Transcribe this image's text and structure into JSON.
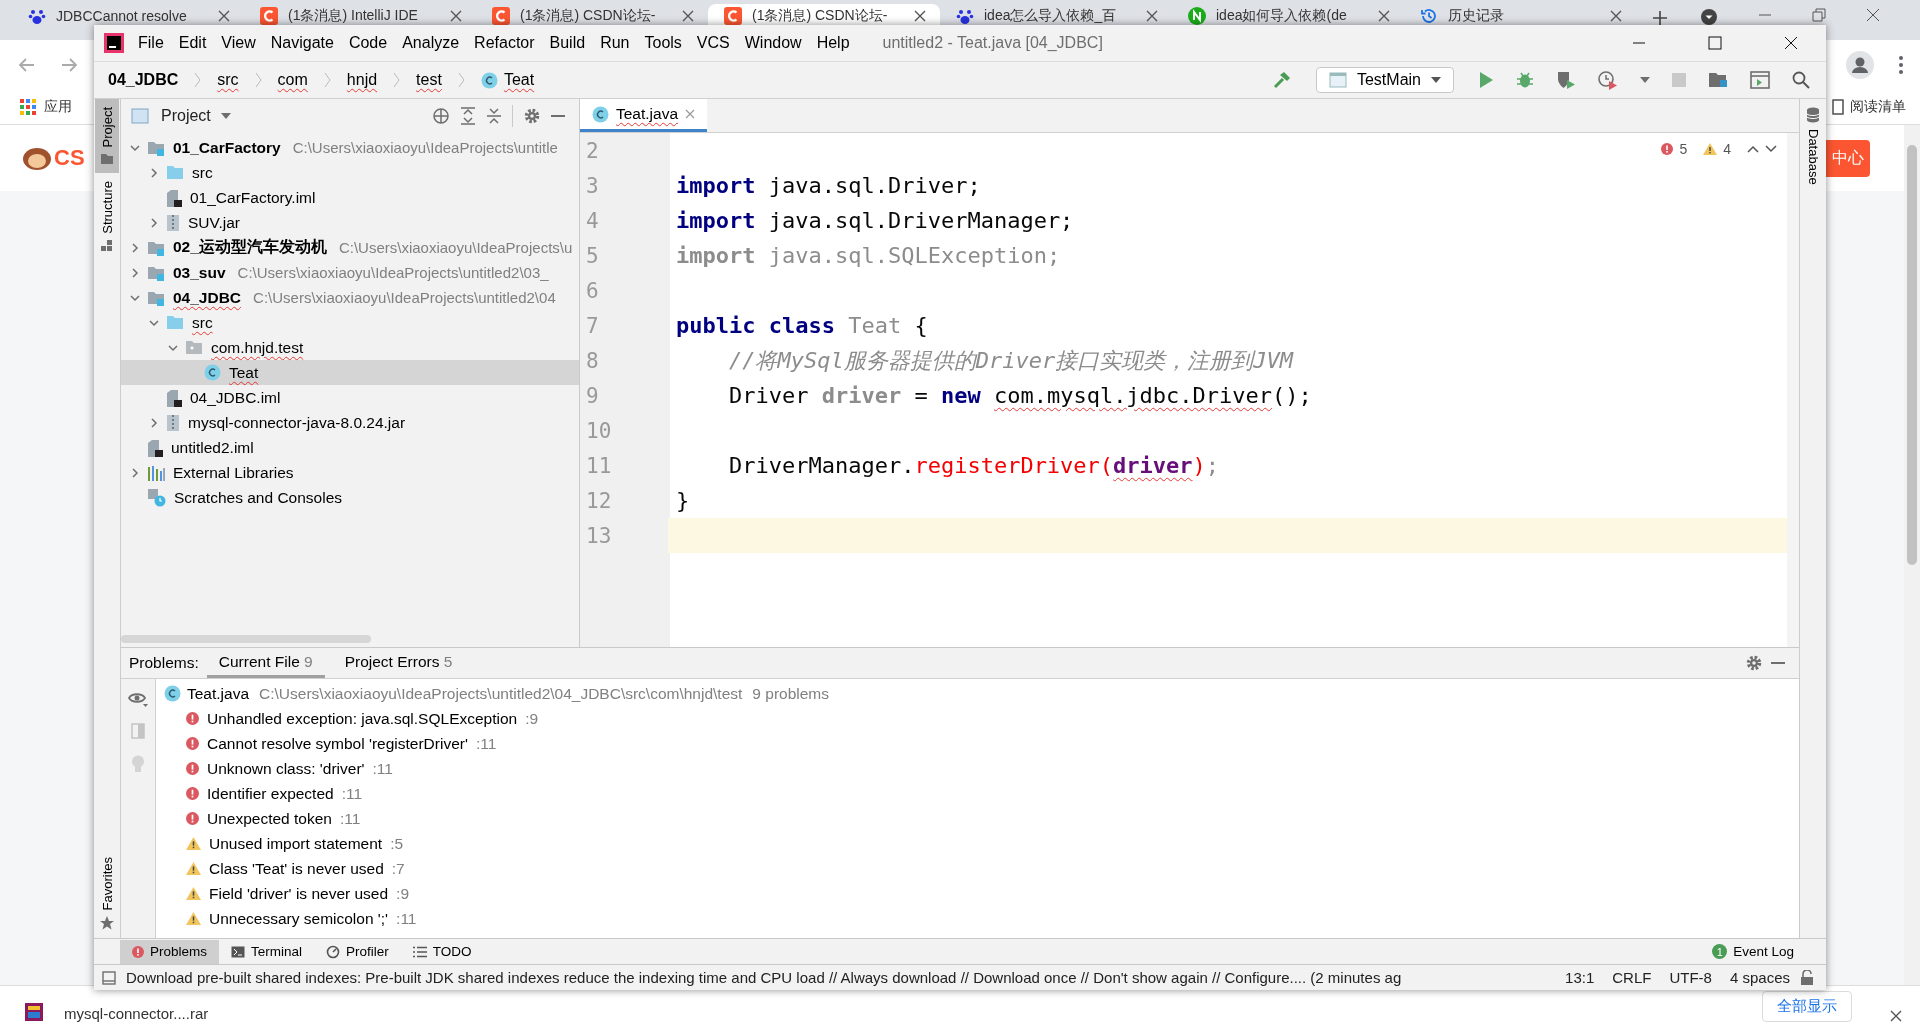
{
  "browser": {
    "tabs": [
      {
        "title": "JDBCCannot resolve",
        "kind": "paw",
        "selected": false
      },
      {
        "title": "(1条消息) IntelliJ IDE",
        "kind": "csdn",
        "selected": false
      },
      {
        "title": "(1条消息) CSDN论坛-",
        "kind": "csdn",
        "selected": false
      },
      {
        "title": "(1条消息) CSDN论坛-",
        "kind": "csdn",
        "selected": true
      },
      {
        "title": "idea怎么导入依赖_百",
        "kind": "paw",
        "selected": false
      },
      {
        "title": "idea如何导入依赖(de",
        "kind": "n",
        "selected": false
      },
      {
        "title": "历史记录",
        "kind": "history",
        "selected": false
      }
    ],
    "bookmarks": [
      "应用"
    ],
    "reading_list": "阅读清单",
    "page": {
      "logo": "CS",
      "button": "中心"
    },
    "download": {
      "file": "mysql-connector....rar",
      "show_all": "全部显示"
    }
  },
  "ide": {
    "title": "untitled2 - Teat.java [04_JDBC]",
    "menu": [
      "File",
      "Edit",
      "View",
      "Navigate",
      "Code",
      "Analyze",
      "Refactor",
      "Build",
      "Run",
      "Tools",
      "VCS",
      "Window",
      "Help"
    ],
    "breadcrumbs": [
      {
        "label": "04_JDBC",
        "kind": "module",
        "error": false
      },
      {
        "label": "src",
        "kind": "dir",
        "error": true
      },
      {
        "label": "com",
        "kind": "dir",
        "error": true
      },
      {
        "label": "hnjd",
        "kind": "dir",
        "error": true
      },
      {
        "label": "test",
        "kind": "dir",
        "error": true
      },
      {
        "label": "Teat",
        "kind": "class",
        "error": true
      }
    ],
    "run_config": "TestMain",
    "left_strip": [
      {
        "label": "Project",
        "selected": true
      },
      {
        "label": "Structure",
        "selected": false
      }
    ],
    "favorites": "Favorites",
    "right_strip": "Database",
    "project_panel": {
      "title": "Project",
      "tree": [
        {
          "label": "01_CarFactory",
          "path": "C:\\Users\\xiaoxiaoyu\\IdeaProjects\\untitle",
          "kind": "module",
          "expanded": true,
          "selected": false,
          "error": false,
          "children": [
            {
              "label": "src",
              "kind": "folder",
              "expanded": false,
              "selected": false,
              "error": false
            },
            {
              "label": "01_CarFactory.iml",
              "kind": "iml",
              "selected": false,
              "error": false
            },
            {
              "label": "SUV.jar",
              "kind": "jar",
              "expanded": false,
              "selected": false,
              "error": false
            }
          ]
        },
        {
          "label": "02_运动型汽车发动机",
          "path": "C:\\Users\\xiaoxiaoyu\\IdeaProjects\\u",
          "kind": "module",
          "expanded": false,
          "selected": false,
          "error": false
        },
        {
          "label": "03_suv",
          "path": "C:\\Users\\xiaoxiaoyu\\IdeaProjects\\untitled2\\03_",
          "kind": "module",
          "expanded": false,
          "selected": false,
          "error": false
        },
        {
          "label": "04_JDBC",
          "path": "C:\\Users\\xiaoxiaoyu\\IdeaProjects\\untitled2\\04",
          "kind": "module",
          "expanded": true,
          "selected": false,
          "error": true,
          "children": [
            {
              "label": "src",
              "kind": "folder",
              "expanded": true,
              "selected": false,
              "error": true,
              "children": [
                {
                  "label": "com.hnjd.test",
                  "kind": "package",
                  "expanded": true,
                  "selected": false,
                  "error": true,
                  "children": [
                    {
                      "label": "Teat",
                      "kind": "class",
                      "selected": true,
                      "error": true
                    }
                  ]
                }
              ]
            },
            {
              "label": "04_JDBC.iml",
              "kind": "iml",
              "selected": false,
              "error": false
            },
            {
              "label": "mysql-connector-java-8.0.24.jar",
              "kind": "jar",
              "expanded": false,
              "selected": false,
              "error": false
            }
          ]
        },
        {
          "label": "untitled2.iml",
          "kind": "iml",
          "selected": false,
          "error": false
        },
        {
          "label": "External Libraries",
          "kind": "libraries",
          "expanded": false,
          "selected": false,
          "error": false
        },
        {
          "label": "Scratches and Consoles",
          "kind": "scratches",
          "selected": false,
          "error": false
        }
      ]
    },
    "editor": {
      "tab": {
        "label": "Teat.java",
        "error": true
      },
      "errors": "5",
      "warnings": "4",
      "lines": [
        {
          "number": "2",
          "current": false
        },
        {
          "number": "3",
          "current": false,
          "tokens": [
            {
              "text": "import",
              "kind": "keyword"
            },
            {
              "text": " java.sql.Driver;",
              "kind": "text"
            }
          ]
        },
        {
          "number": "4",
          "current": false,
          "tokens": [
            {
              "text": "import",
              "kind": "keyword"
            },
            {
              "text": " java.sql.DriverManager;",
              "kind": "text"
            }
          ]
        },
        {
          "number": "5",
          "current": false,
          "tokens": [
            {
              "text": "import",
              "kind": "unused-keyword"
            },
            {
              "text": " java.sql.SQLException;",
              "kind": "unused"
            }
          ]
        },
        {
          "number": "6",
          "current": false
        },
        {
          "number": "7",
          "current": false,
          "tokens": [
            {
              "text": "public class",
              "kind": "keyword"
            },
            {
              "text": " Teat",
              "kind": "unused"
            },
            {
              "text": " {",
              "kind": "text"
            }
          ]
        },
        {
          "number": "8",
          "current": false,
          "tokens": [
            {
              "text": "    //将MySql服务器提供的Driver接口实现类，注册到JVM",
              "kind": "comment"
            }
          ]
        },
        {
          "number": "9",
          "current": false,
          "tokens": [
            {
              "text": "    Driver ",
              "kind": "text"
            },
            {
              "text": "driver",
              "kind": "unused-keyword"
            },
            {
              "text": " = ",
              "kind": "text"
            },
            {
              "text": "new ",
              "kind": "keyword"
            },
            {
              "text": "com.mysql.jdbc.Driver",
              "kind": "unresolved"
            },
            {
              "text": "();",
              "kind": "text"
            }
          ]
        },
        {
          "number": "10",
          "current": false
        },
        {
          "number": "11",
          "current": false,
          "tokens": [
            {
              "text": "    DriverManager.",
              "kind": "text"
            },
            {
              "text": "registerDriver(",
              "kind": "error-call"
            },
            {
              "text": "driver",
              "kind": "error-arg"
            },
            {
              "text": ")",
              "kind": "error-call"
            },
            {
              "text": ";",
              "kind": "unused"
            }
          ]
        },
        {
          "number": "12",
          "current": false,
          "tokens": [
            {
              "text": "}",
              "kind": "text"
            }
          ]
        },
        {
          "number": "13",
          "current": true
        }
      ]
    },
    "problems": {
      "label": "Problems:",
      "tabs": [
        {
          "label": "Current File",
          "count": "9",
          "selected": true
        },
        {
          "label": "Project Errors",
          "count": "5",
          "selected": false
        }
      ],
      "file": {
        "name": "Teat.java",
        "path": "C:\\Users\\xiaoxiaoyu\\IdeaProjects\\untitled2\\04_JDBC\\src\\com\\hnjd\\test",
        "summary": "9 problems"
      },
      "items": [
        {
          "kind": "error",
          "text": "Unhandled exception: java.sql.SQLException",
          "line": ":9"
        },
        {
          "kind": "error",
          "text": "Cannot resolve symbol 'registerDriver'",
          "line": ":11"
        },
        {
          "kind": "error",
          "text": "Unknown class: 'driver'",
          "line": ":11"
        },
        {
          "kind": "error",
          "text": "Identifier expected",
          "line": ":11"
        },
        {
          "kind": "error",
          "text": "Unexpected token",
          "line": ":11"
        },
        {
          "kind": "warning",
          "text": "Unused import statement",
          "line": ":5"
        },
        {
          "kind": "warning",
          "text": "Class 'Teat' is never used",
          "line": ":7"
        },
        {
          "kind": "warning",
          "text": "Field 'driver' is never used",
          "line": ":9"
        },
        {
          "kind": "warning",
          "text": "Unnecessary semicolon ';'",
          "line": ":11"
        }
      ]
    },
    "tool_tabs": [
      {
        "label": "Problems",
        "kind": "error",
        "selected": true
      },
      {
        "label": "Terminal",
        "kind": "terminal",
        "selected": false
      },
      {
        "label": "Profiler",
        "kind": "profiler",
        "selected": false
      },
      {
        "label": "TODO",
        "kind": "list",
        "selected": false
      }
    ],
    "event_log": {
      "label": "Event Log",
      "count": "1"
    },
    "status": {
      "message": "Download pre-built shared indexes: Pre-built JDK shared indexes reduce the indexing time and CPU load // Always download // Download once // Don't show again // Configure.... (2 minutes ag",
      "position": "13:1",
      "line_ending": "CRLF",
      "encoding": "UTF-8",
      "indent": "4 spaces"
    }
  }
}
